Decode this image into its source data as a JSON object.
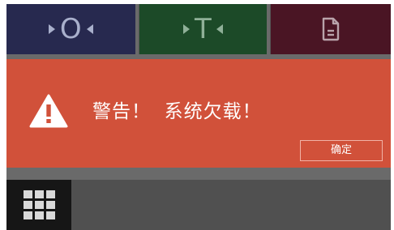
{
  "topbar": {
    "zero_key": {
      "letter": "O",
      "icon": "zero-key-icon"
    },
    "tare_key": {
      "letter": "T",
      "icon": "tare-key-icon"
    },
    "doc_key": {
      "icon": "document-icon"
    }
  },
  "alert": {
    "icon": "warning-icon",
    "message": "警告！  系统欠载！",
    "ok_label": "确定",
    "color": "#d1513a"
  },
  "bottom": {
    "apps_icon": "grid-menu-icon"
  },
  "colors": {
    "zero": "#27294f",
    "tare": "#1c4a28",
    "doc": "#4a1524",
    "bottom_bar": "#505050"
  }
}
